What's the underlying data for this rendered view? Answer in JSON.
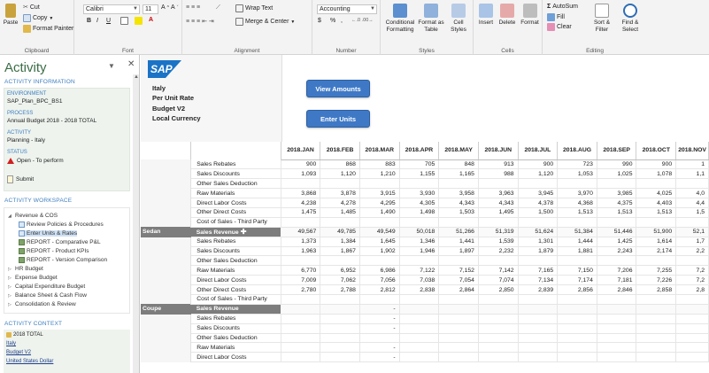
{
  "ribbon": {
    "clipboard": {
      "cut": "Cut",
      "copy": "Copy",
      "paste": "Paste",
      "format_painter": "Format Painter",
      "caption": "Clipboard"
    },
    "font": {
      "name": "Calibri",
      "size": "11",
      "bold": "B",
      "italic": "I",
      "underline": "U",
      "caption": "Font"
    },
    "alignment": {
      "wrap_text": "Wrap Text",
      "merge_center": "Merge & Center",
      "caption": "Alignment"
    },
    "number": {
      "format": "Accounting",
      "currency": "$",
      "percent": "%",
      "comma": ",",
      "caption": "Number"
    },
    "styles": {
      "conditional": "Conditional Formatting",
      "format_table": "Format as Table",
      "cell_styles": "Cell Styles",
      "caption": "Styles"
    },
    "cells": {
      "insert": "Insert",
      "delete": "Delete",
      "format": "Format",
      "caption": "Cells"
    },
    "editing": {
      "autosum": "AutoSum",
      "fill": "Fill",
      "clear": "Clear",
      "sort_filter": "Sort & Filter",
      "find_select": "Find & Select",
      "caption": "Editing"
    }
  },
  "pane": {
    "title": "Activity",
    "info_header": "ACTIVITY INFORMATION",
    "environment_label": "ENVIRONMENT",
    "environment_value": "SAP_Plan_BPC_BS1",
    "process_label": "PROCESS",
    "process_value": "Annual Budget 2018 - 2018 TOTAL",
    "activity_label": "ACTIVITY",
    "activity_value": "Planning - Italy",
    "status_label": "STATUS",
    "status_value": "Open - To perform",
    "submit": "Submit",
    "workspace_header": "ACTIVITY WORKSPACE",
    "tree": [
      {
        "label": "Revenue & COS",
        "level": 0,
        "expanded": true
      },
      {
        "label": "Review Policies & Procedures",
        "level": 2,
        "kind": "doc"
      },
      {
        "label": "Enter Units & Rates",
        "level": 2,
        "kind": "doc",
        "selected": true
      },
      {
        "label": "REPORT - Comparative P&L",
        "level": 2,
        "kind": "report"
      },
      {
        "label": "REPORT - Product KPIs",
        "level": 2,
        "kind": "report"
      },
      {
        "label": "REPORT - Version Comparison",
        "level": 2,
        "kind": "report"
      },
      {
        "label": "HR Budget",
        "level": 0,
        "expanded": false
      },
      {
        "label": "Expense Budget",
        "level": 0,
        "expanded": false
      },
      {
        "label": "Capital Expenditure Budget",
        "level": 0,
        "expanded": false
      },
      {
        "label": "Balance Sheet & Cash Flow",
        "level": 0,
        "expanded": false
      },
      {
        "label": "Consolidation & Review",
        "level": 0,
        "expanded": false
      }
    ],
    "context_header": "ACTIVITY CONTEXT",
    "context": [
      "2018 TOTAL",
      "Italy",
      "Budget V2",
      "United States Dollar"
    ]
  },
  "sheet": {
    "logo_text": "SAP",
    "meta": [
      "Italy",
      "Per Unit Rate",
      "Budget V2",
      "Local Currency"
    ],
    "btn_view": "View Amounts",
    "btn_enter": "Enter Units",
    "columns": [
      "2018.JAN",
      "2018.FEB",
      "2018.MAR",
      "2018.APR",
      "2018.MAY",
      "2018.JUN",
      "2018.JUL",
      "2018.AUG",
      "2018.SEP",
      "2018.OCT",
      "2018.NOV"
    ],
    "rows": [
      {
        "group": "",
        "item": "Sales Rebates",
        "values": [
          "900",
          "868",
          "883",
          "705",
          "848",
          "913",
          "900",
          "723",
          "990",
          "900",
          "1"
        ]
      },
      {
        "group": "",
        "item": "Sales Discounts",
        "values": [
          "1,093",
          "1,120",
          "1,210",
          "1,155",
          "1,165",
          "988",
          "1,120",
          "1,053",
          "1,025",
          "1,078",
          "1,1"
        ]
      },
      {
        "group": "",
        "item": "Other Sales Deduction",
        "values": [
          "",
          "",
          "",
          "",
          "",
          "",
          "",
          "",
          "",
          "",
          ""
        ]
      },
      {
        "group": "",
        "item": "Raw Materials",
        "values": [
          "3,868",
          "3,878",
          "3,915",
          "3,930",
          "3,958",
          "3,963",
          "3,945",
          "3,970",
          "3,985",
          "4,025",
          "4,0"
        ]
      },
      {
        "group": "",
        "item": "Direct Labor Costs",
        "values": [
          "4,238",
          "4,278",
          "4,295",
          "4,305",
          "4,343",
          "4,343",
          "4,378",
          "4,368",
          "4,375",
          "4,403",
          "4,4"
        ]
      },
      {
        "group": "",
        "item": "Other Direct Costs",
        "values": [
          "1,475",
          "1,485",
          "1,490",
          "1,498",
          "1,503",
          "1,495",
          "1,500",
          "1,513",
          "1,513",
          "1,513",
          "1,5"
        ]
      },
      {
        "group": "",
        "item": "Cost of Sales - Third Party",
        "values": [
          "",
          "",
          "",
          "",
          "",
          "",
          "",
          "",
          "",
          "",
          ""
        ]
      },
      {
        "group": "Sedan",
        "item": "Sales Revenue",
        "dark": true,
        "values": [
          "49,567",
          "49,785",
          "49,549",
          "50,018",
          "51,266",
          "51,319",
          "51,624",
          "51,384",
          "51,446",
          "51,900",
          "52,1"
        ]
      },
      {
        "group": "",
        "item": "Sales Rebates",
        "values": [
          "1,373",
          "1,384",
          "1,645",
          "1,346",
          "1,441",
          "1,539",
          "1,301",
          "1,444",
          "1,425",
          "1,614",
          "1,7"
        ]
      },
      {
        "group": "",
        "item": "Sales Discounts",
        "values": [
          "1,963",
          "1,867",
          "1,902",
          "1,946",
          "1,897",
          "2,232",
          "1,879",
          "1,881",
          "2,243",
          "2,174",
          "2,2"
        ]
      },
      {
        "group": "",
        "item": "Other Sales Deduction",
        "values": [
          "",
          "",
          "",
          "",
          "",
          "",
          "",
          "",
          "",
          "",
          ""
        ]
      },
      {
        "group": "",
        "item": "Raw Materials",
        "values": [
          "6,770",
          "6,952",
          "6,986",
          "7,122",
          "7,152",
          "7,142",
          "7,165",
          "7,150",
          "7,206",
          "7,255",
          "7,2"
        ]
      },
      {
        "group": "",
        "item": "Direct Labor Costs",
        "values": [
          "7,009",
          "7,062",
          "7,056",
          "7,038",
          "7,054",
          "7,074",
          "7,134",
          "7,174",
          "7,181",
          "7,226",
          "7,2"
        ]
      },
      {
        "group": "",
        "item": "Other Direct Costs",
        "values": [
          "2,780",
          "2,788",
          "2,812",
          "2,838",
          "2,864",
          "2,850",
          "2,839",
          "2,856",
          "2,846",
          "2,858",
          "2,8"
        ]
      },
      {
        "group": "",
        "item": "Cost of Sales - Third Party",
        "values": [
          "",
          "",
          "",
          "",
          "",
          "",
          "",
          "",
          "",
          "",
          ""
        ]
      },
      {
        "group": "Coupe",
        "item": "Sales Revenue",
        "dark": true,
        "values": [
          "",
          "",
          "-",
          "",
          "",
          "",
          "",
          "",
          "",
          "",
          ""
        ]
      },
      {
        "group": "",
        "item": "Sales Rebates",
        "values": [
          "",
          "",
          "-",
          "",
          "",
          "",
          "",
          "",
          "",
          "",
          ""
        ]
      },
      {
        "group": "",
        "item": "Sales Discounts",
        "values": [
          "",
          "",
          "-",
          "",
          "",
          "",
          "",
          "",
          "",
          "",
          ""
        ]
      },
      {
        "group": "",
        "item": "Other Sales Deduction",
        "values": [
          "",
          "",
          "",
          "",
          "",
          "",
          "",
          "",
          "",
          "",
          ""
        ]
      },
      {
        "group": "",
        "item": "Raw Materials",
        "values": [
          "",
          "",
          "-",
          "",
          "",
          "",
          "",
          "",
          "",
          "",
          ""
        ]
      },
      {
        "group": "",
        "item": "Direct Labor Costs",
        "values": [
          "",
          "",
          "-",
          "",
          "",
          "",
          "",
          "",
          "",
          "",
          ""
        ]
      }
    ]
  }
}
